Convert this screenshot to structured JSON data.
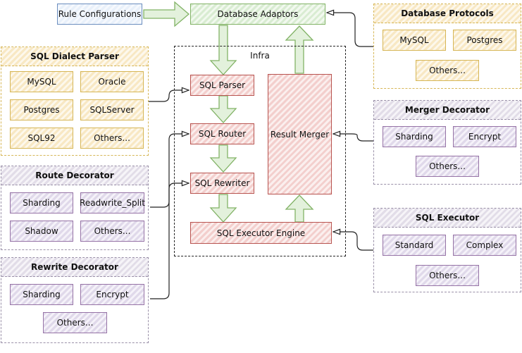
{
  "top": {
    "rule_configurations": "Rule Configurations",
    "database_adaptors": "Database Adaptors"
  },
  "infra": {
    "label": "Infra",
    "sql_parser": "SQL Parser",
    "sql_router": "SQL Router",
    "sql_rewriter": "SQL Rewriter",
    "sql_executor_engine": "SQL Executor Engine",
    "result_merger": "Result Merger"
  },
  "sql_dialect_parser": {
    "title": "SQL Dialect Parser",
    "items": [
      "MySQL",
      "Oracle",
      "Postgres",
      "SQLServer",
      "SQL92",
      "Others..."
    ]
  },
  "route_decorator": {
    "title": "Route Decorator",
    "items": [
      "Sharding",
      "Readwrite_Split",
      "Shadow",
      "Others..."
    ]
  },
  "rewrite_decorator": {
    "title": "Rewrite Decorator",
    "items": [
      "Sharding",
      "Encrypt",
      "Others..."
    ]
  },
  "database_protocols": {
    "title": "Database Protocols",
    "items": [
      "MySQL",
      "Postgres",
      "Others..."
    ]
  },
  "merger_decorator": {
    "title": "Merger Decorator",
    "items": [
      "Sharding",
      "Encrypt",
      "Others..."
    ]
  },
  "sql_executor": {
    "title": "SQL Executor",
    "items": [
      "Standard",
      "Complex",
      "Others..."
    ]
  }
}
